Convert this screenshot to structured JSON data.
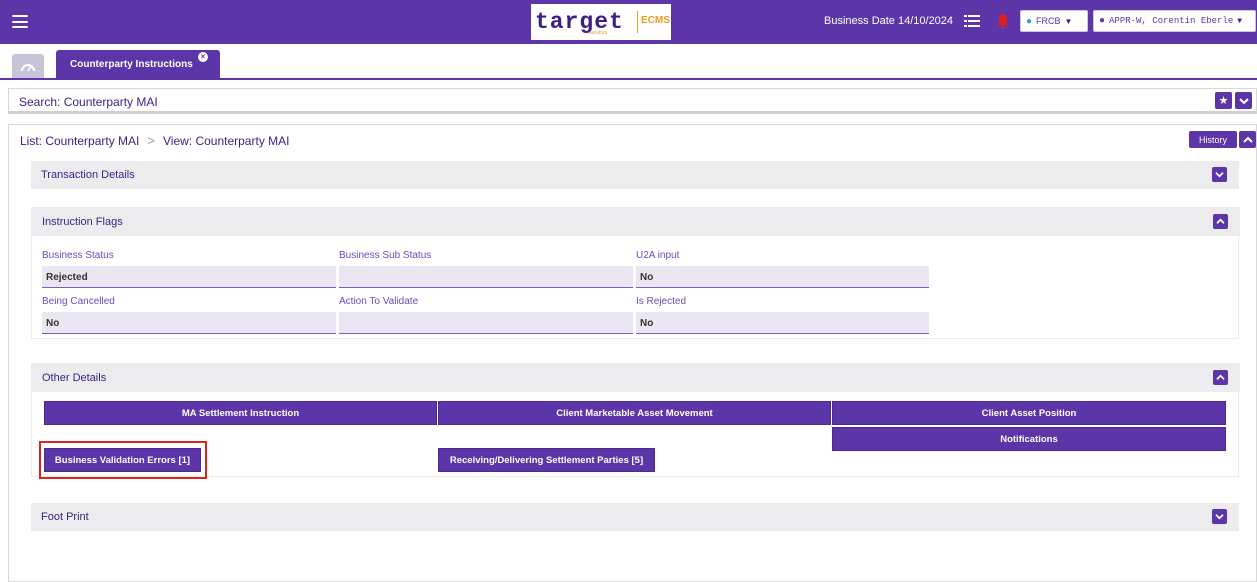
{
  "header": {
    "logo_text": "target",
    "logo_sub": "services",
    "logo_ecms": "ECMS",
    "business_date": "Business Date 14/10/2024",
    "institution": "FRCB",
    "user": "APPR-W, Corentin Eberle"
  },
  "tabs": {
    "active_tab": "Counterparty Instructions"
  },
  "search": {
    "title": "Search: Counterparty MAI"
  },
  "breadcrumb": {
    "list": "List: Counterparty MAI",
    "separator": ">",
    "view": "View: Counterparty MAI"
  },
  "history_label": "History",
  "sections": {
    "transaction_details": "Transaction Details",
    "instruction_flags": "Instruction Flags",
    "other_details": "Other Details",
    "foot_print": "Foot Print"
  },
  "fields": {
    "business_status": {
      "label": "Business Status",
      "value": "Rejected"
    },
    "business_sub_status": {
      "label": "Business Sub Status",
      "value": ""
    },
    "u2a_input": {
      "label": "U2A input",
      "value": "No"
    },
    "being_cancelled": {
      "label": "Being Cancelled",
      "value": "No"
    },
    "action_to_validate": {
      "label": "Action To Validate",
      "value": ""
    },
    "is_rejected": {
      "label": "Is Rejected",
      "value": "No"
    }
  },
  "buttons": {
    "ma_settlement": "MA Settlement Instruction",
    "client_marketable": "Client Marketable Asset Movement",
    "client_asset_position": "Client Asset Position",
    "notifications": "Notifications",
    "business_validation_errors": "Business Validation Errors [1]",
    "receiving_delivering": "Receiving/Delivering Settlement Parties [5]"
  },
  "colors": {
    "primary": "#5c35a9",
    "accent": "#f29b1d",
    "highlight": "#e0201c"
  }
}
